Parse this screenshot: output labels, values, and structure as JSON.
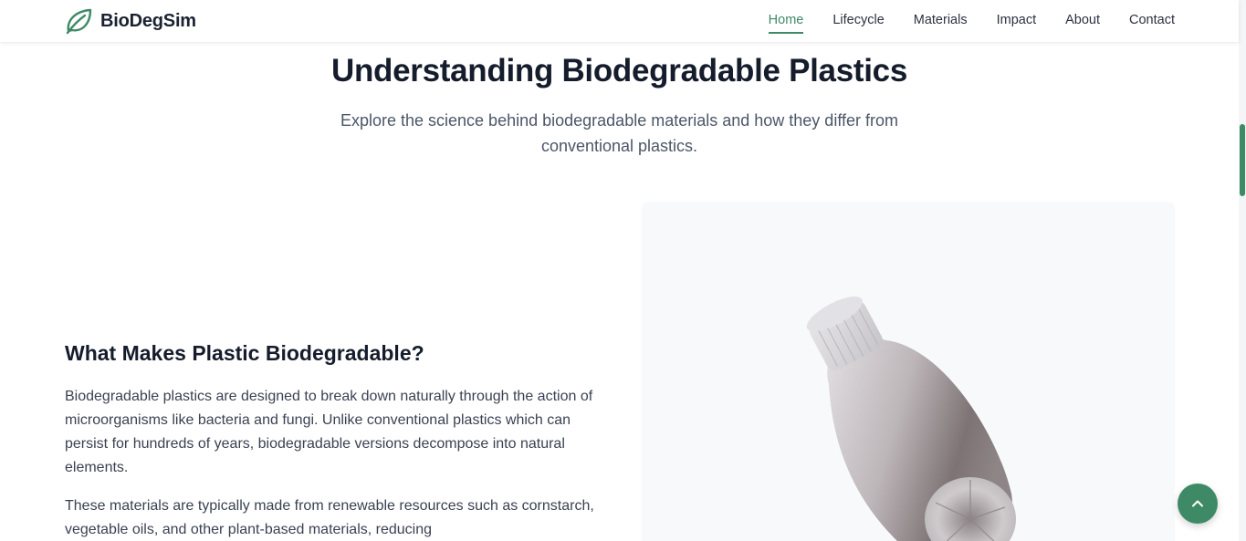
{
  "brand": {
    "name": "BioDegSim",
    "logo_icon": "leaf-icon",
    "accent_color": "#3f8a66"
  },
  "nav": {
    "items": [
      {
        "label": "Home",
        "active": true
      },
      {
        "label": "Lifecycle",
        "active": false
      },
      {
        "label": "Materials",
        "active": false
      },
      {
        "label": "Impact",
        "active": false
      },
      {
        "label": "About",
        "active": false
      },
      {
        "label": "Contact",
        "active": false
      }
    ]
  },
  "hero": {
    "title": "Understanding Biodegradable Plastics",
    "subtitle": "Explore the science behind biodegradable materials and how they differ from conventional plastics."
  },
  "content": {
    "heading": "What Makes Plastic Biodegradable?",
    "paragraphs": [
      "Biodegradable plastics are designed to break down naturally through the action of microorganisms like bacteria and fungi. Unlike conventional plastics which can persist for hundreds of years, biodegradable versions decompose into natural elements.",
      "These materials are typically made from renewable resources such as cornstarch, vegetable oils, and other plant-based materials, reducing"
    ]
  },
  "model_viewer": {
    "icon": "bottle-3d-model"
  },
  "back_to_top": {
    "icon": "chevron-up-icon"
  }
}
